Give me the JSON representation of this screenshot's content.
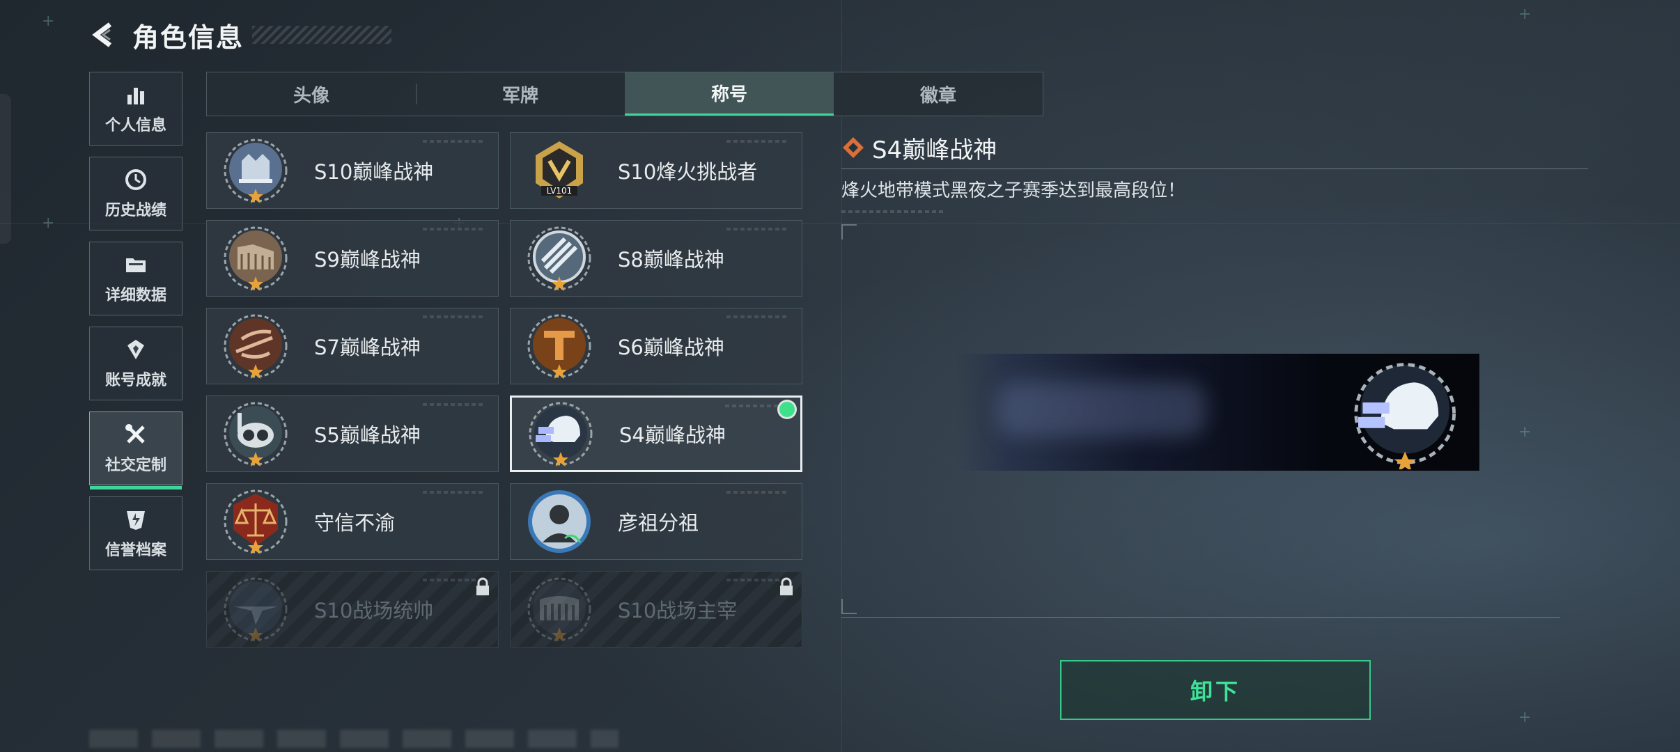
{
  "header": {
    "title": "角色信息",
    "back_icon": "back-arrow-icon"
  },
  "sidebar": {
    "items": [
      {
        "label": "个人信息",
        "icon": "bar-chart-icon",
        "active": false
      },
      {
        "label": "历史战绩",
        "icon": "history-clock-icon",
        "active": false
      },
      {
        "label": "详细数据",
        "icon": "folder-icon",
        "active": false
      },
      {
        "label": "账号成就",
        "icon": "achievement-icon",
        "active": false
      },
      {
        "label": "社交定制",
        "icon": "tools-icon",
        "active": true
      },
      {
        "label": "信誉档案",
        "icon": "credit-shield-icon",
        "active": false
      }
    ]
  },
  "tabs": [
    {
      "label": "头像",
      "active": false
    },
    {
      "label": "军牌",
      "active": false
    },
    {
      "label": "称号",
      "active": true
    },
    {
      "label": "徽章",
      "active": false
    }
  ],
  "titles": [
    {
      "name": "S10巅峰战神",
      "state": "normal",
      "icon": "fortress-emblem-icon"
    },
    {
      "name": "S10烽火挑战者",
      "state": "normal",
      "icon": "gold-lv101-emblem-icon",
      "level_text": "LV101"
    },
    {
      "name": "S9巅峰战神",
      "state": "normal",
      "icon": "ruins-emblem-icon"
    },
    {
      "name": "S8巅峰战神",
      "state": "normal",
      "icon": "slash-emblem-icon"
    },
    {
      "name": "S7巅峰战神",
      "state": "normal",
      "icon": "crossbow-emblem-icon"
    },
    {
      "name": "S6巅峰战神",
      "state": "normal",
      "icon": "t-emblem-icon"
    },
    {
      "name": "S5巅峰战神",
      "state": "normal",
      "icon": "diving-mask-emblem-icon"
    },
    {
      "name": "S4巅峰战神",
      "state": "selected",
      "icon": "night-vision-helmet-emblem-icon"
    },
    {
      "name": "守信不渝",
      "state": "normal",
      "icon": "scales-emblem-icon"
    },
    {
      "name": "彦祖分祖",
      "state": "normal",
      "icon": "portrait-emblem-icon"
    },
    {
      "name": "S10战场统帅",
      "state": "locked",
      "icon": "aircraft-emblem-icon"
    },
    {
      "name": "S10战场主宰",
      "state": "locked",
      "icon": "colosseum-emblem-icon"
    }
  ],
  "detail": {
    "title": "S4巅峰战神",
    "description": "烽火地带模式黑夜之子赛季达到最高段位！",
    "title_icon": "diamond-icon",
    "preview_icon": "night-vision-helmet-emblem-icon"
  },
  "actions": {
    "unequip_label": "卸下"
  },
  "colors": {
    "accent": "#3ed69a",
    "active_dot": "#3ee08c",
    "star": "#e8a23a",
    "background": "#242d35"
  }
}
